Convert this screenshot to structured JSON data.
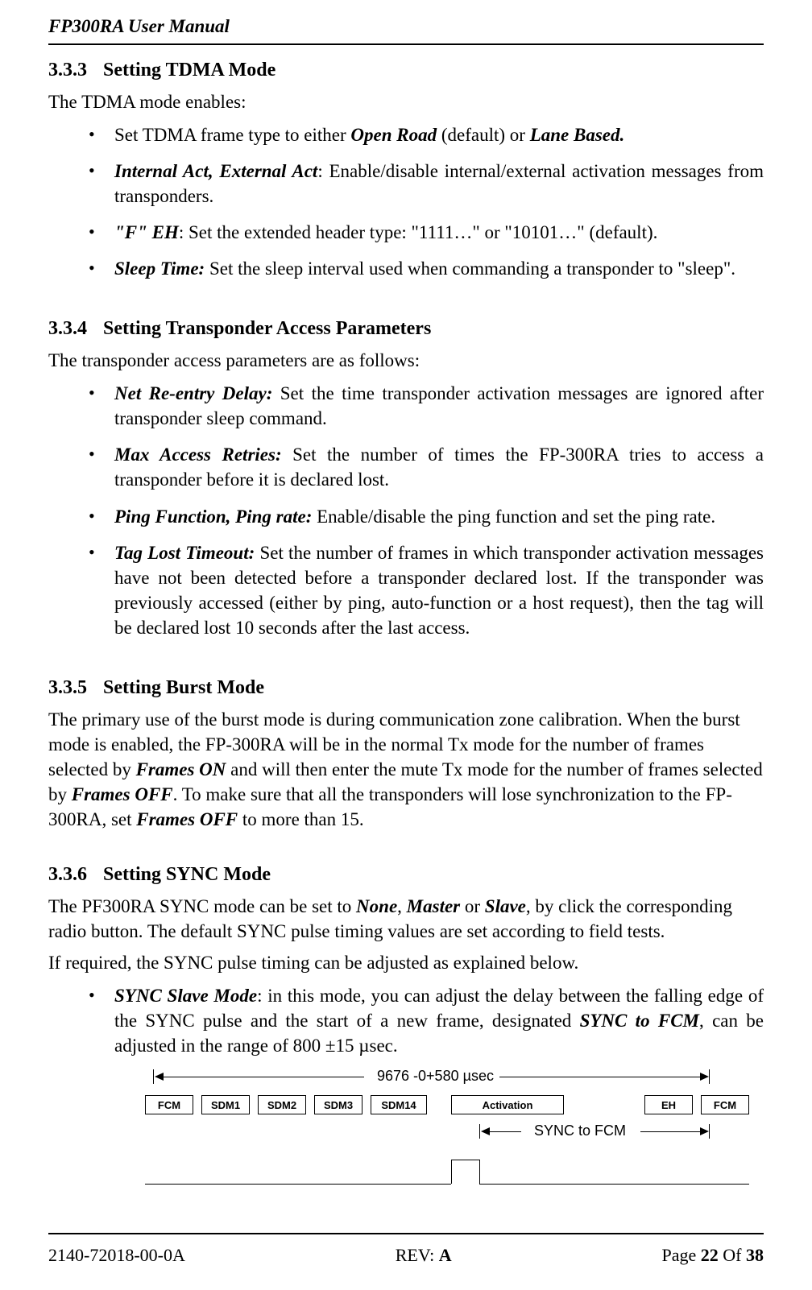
{
  "header": {
    "doc_title": "FP300RA User Manual"
  },
  "s333": {
    "num": "3.3.3",
    "title": "Setting TDMA Mode",
    "intro": "The TDMA mode enables:",
    "b1_pre": "Set TDMA frame type to either ",
    "b1_em1": "Open Road",
    "b1_mid": " (default) or ",
    "b1_em2": "Lane Based.",
    "b2_em": "Internal Act, External Act",
    "b2_rest": ": Enable/disable internal/external activation messages from transponders.",
    "b3_em": "\"F\" EH",
    "b3_rest": ": Set the extended header type: \"1111…\" or \"10101…\" (default).",
    "b4_em": "Sleep Time:",
    "b4_rest": " Set the sleep interval used when commanding a transponder to \"sleep\"."
  },
  "s334": {
    "num": "3.3.4",
    "title": "Setting Transponder Access Parameters",
    "intro": "The transponder access parameters are as follows:",
    "b1_em": "Net Re-entry Delay:",
    "b1_rest": " Set the time transponder activation messages are ignored after transponder sleep command.",
    "b2_em": "Max Access Retries:",
    "b2_rest": " Set the number of times the FP-300RA tries to access a transponder before it is declared lost.",
    "b3_em": "Ping Function, Ping rate:",
    "b3_rest": " Enable/disable the ping function and set the ping rate.",
    "b4_em": "Tag Lost Timeout:",
    "b4_rest": " Set the number of frames in which transponder activation messages have not been detected before a transponder declared lost. If the transponder was previously accessed (either by ping, auto-function or a host request), then the tag will be declared lost 10 seconds after the last access."
  },
  "s335": {
    "num": "3.3.5",
    "title": "Setting Burst Mode",
    "p_a": "The primary use of the burst mode is during communication zone calibration. When the burst mode is enabled, the FP-300RA will be in the normal Tx mode for the number of frames selected by ",
    "p_em1": "Frames ON",
    "p_b": " and will then enter the mute Tx mode for the number of frames selected by ",
    "p_em2": "Frames OFF",
    "p_c": ". To make sure that all the transponders will lose synchronization to the FP-300RA, set ",
    "p_em3": "Frames OFF",
    "p_d": " to more than 15."
  },
  "s336": {
    "num": "3.3.6",
    "title": "Setting SYNC Mode",
    "p1_a": "The PF300RA SYNC mode can be set to ",
    "p1_em1": "None",
    "p1_b": ", ",
    "p1_em2": "Master",
    "p1_c": " or ",
    "p1_em3": "Slave",
    "p1_d": ", by click the corresponding radio button. The default SYNC pulse timing values are set according to field tests.",
    "p2": "If required, the SYNC pulse timing can be adjusted as explained below.",
    "b1_em": "SYNC Slave Mode",
    "b1_mid": ": in this mode, you can adjust the delay between the falling edge of the SYNC pulse and the start of a new frame, designated ",
    "b1_em2": "SYNC to FCM",
    "b1_end": ", can be adjusted in the range of 800 ±15 µsec."
  },
  "diagram": {
    "total_label": "9676 -0+580 µsec",
    "sync_label": "SYNC to FCM",
    "boxes": [
      "FCM",
      "SDM1",
      "SDM2",
      "SDM3",
      "SDM14",
      "Activation",
      "EH",
      "FCM"
    ]
  },
  "footer": {
    "left": "2140-72018-00-0A",
    "center_a": "REV: ",
    "center_b": "A",
    "right_a": "Page ",
    "right_b": "22",
    "right_c": " Of  ",
    "right_d": "38"
  }
}
